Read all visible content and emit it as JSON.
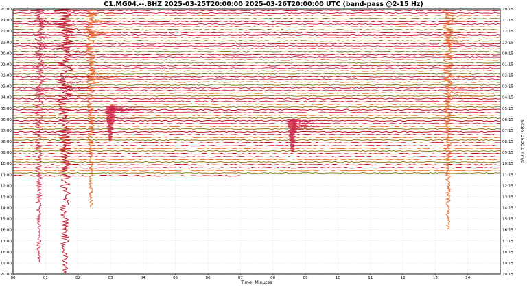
{
  "chart_data": {
    "type": "helicorder",
    "title": "C1.MG04.--.BHZ 2025-03-25T20:00:00 2025-03-26T20:00:00 UTC (band-pass @2-15 Hz)",
    "xlabel": "Time: Minutes",
    "right_label": "Scale: 2500.0 nm/s",
    "x_range": [
      0,
      15
    ],
    "x_ticks": [
      "00",
      "01",
      "02",
      "03",
      "04",
      "05",
      "06",
      "07",
      "08",
      "09",
      "10",
      "11",
      "12",
      "13",
      "14"
    ],
    "left_ticks": [
      "20:00",
      "21:00",
      "22:00",
      "23:00",
      "00:00",
      "01:00",
      "02:00",
      "03:00",
      "04:00",
      "05:00",
      "06:00",
      "07:00",
      "08:00",
      "09:00",
      "10:00",
      "11:00",
      "12:00",
      "13:00",
      "14:00",
      "15:00",
      "16:00",
      "17:00",
      "18:00",
      "19:00",
      "20:00"
    ],
    "right_ticks": [
      "20:15",
      "21:15",
      "22:15",
      "23:15",
      "00:15",
      "01:15",
      "02:15",
      "03:15",
      "04:15",
      "05:15",
      "06:15",
      "07:15",
      "08:15",
      "09:15",
      "10:15",
      "11:15",
      "12:15",
      "13:15",
      "14:15",
      "15:15",
      "16:15",
      "17:15",
      "18:15",
      "19:15",
      "20:15"
    ],
    "row_minutes": 15,
    "rows_total": 96,
    "rows_filled": 61,
    "last_trace_end_minute": 7,
    "trace_colors": [
      "#b80018",
      "#cc2244",
      "#e8621c",
      "#7a7a14",
      "#111111"
    ],
    "grid": true,
    "events": [
      {
        "minute": 0.8,
        "rows": [
          0,
          92
        ],
        "color": "#cc2244"
      },
      {
        "minute": 1.6,
        "rows": [
          0,
          96
        ],
        "color": "#b80018"
      },
      {
        "minute": 2.4,
        "rows": [
          0,
          72
        ],
        "color": "#e8621c"
      },
      {
        "minute": 3.0,
        "rows": [
          35,
          48
        ],
        "color": "#cc2244"
      },
      {
        "minute": 8.6,
        "rows": [
          40,
          52
        ],
        "color": "#cc2244"
      },
      {
        "minute": 13.4,
        "rows": [
          0,
          80
        ],
        "color": "#e8621c"
      }
    ]
  }
}
